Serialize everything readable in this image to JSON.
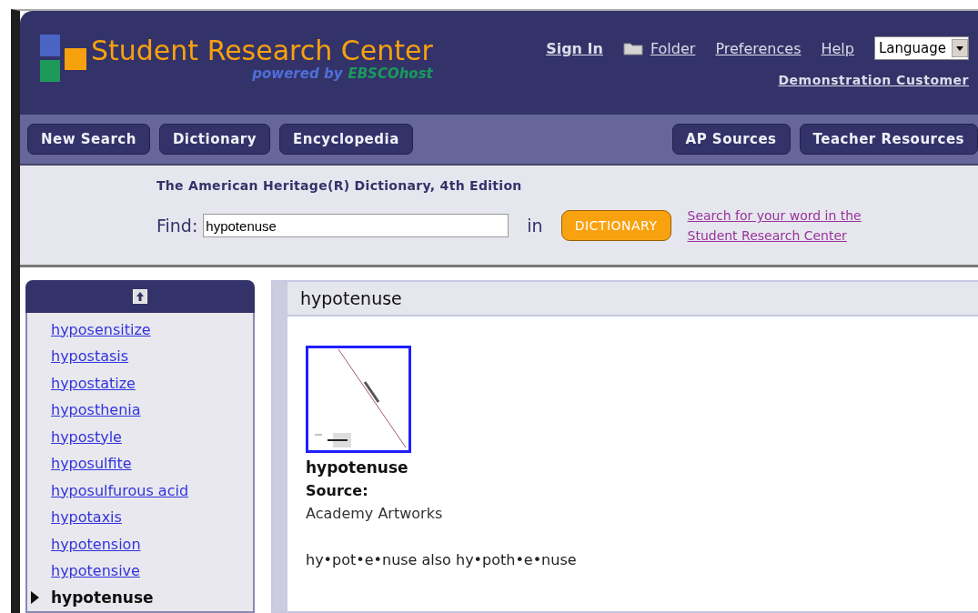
{
  "header": {
    "logo_title": "Student Research Center",
    "logo_powered": "powered by",
    "logo_brand": "EBSCOhost",
    "links": [
      {
        "label": "Sign In",
        "kind": "bold"
      },
      {
        "label": "Folder",
        "kind": "folder"
      },
      {
        "label": "Preferences",
        "kind": "plain"
      },
      {
        "label": "Help",
        "kind": "plain"
      }
    ],
    "language": "Language",
    "customer": "Demonstration Customer"
  },
  "nav": {
    "left": [
      "New Search",
      "Dictionary",
      "Encyclopedia"
    ],
    "right": [
      "AP Sources",
      "Teacher Resources"
    ]
  },
  "find": {
    "title": "The American Heritage(R) Dictionary, 4th Edition",
    "label": "Find:",
    "value": "hypotenuse",
    "in": "in",
    "button": "DICTIONARY",
    "link": "Search for your word in the Student Research Center"
  },
  "sidebar": {
    "items": [
      {
        "label": "hyposensitize",
        "selected": false
      },
      {
        "label": "hypostasis",
        "selected": false
      },
      {
        "label": "hypostatize",
        "selected": false
      },
      {
        "label": "hyposthenia",
        "selected": false
      },
      {
        "label": "hypostyle",
        "selected": false
      },
      {
        "label": "hyposulfite",
        "selected": false
      },
      {
        "label": "hyposulfurous acid",
        "selected": false
      },
      {
        "label": "hypotaxis",
        "selected": false
      },
      {
        "label": "hypotension",
        "selected": false
      },
      {
        "label": "hypotensive",
        "selected": false
      },
      {
        "label": "hypotenuse",
        "selected": true
      }
    ]
  },
  "entry": {
    "title": "hypotenuse",
    "headword": "hypotenuse",
    "source_label": "Source:",
    "source": "Academy Artworks",
    "pronunciation": "hy•pot•e•nuse also hy•poth•e•nuse"
  }
}
